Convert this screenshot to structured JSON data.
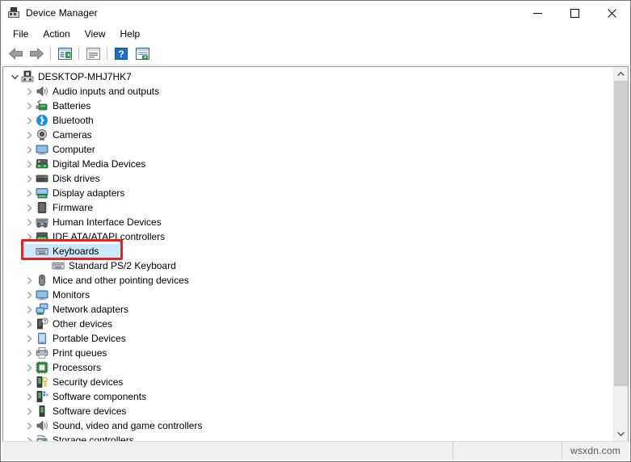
{
  "window": {
    "title": "Device Manager",
    "title_icon": "device-manager-icon",
    "minimize_label": "minimize-icon",
    "maximize_label": "maximize-icon",
    "close_label": "close-icon"
  },
  "menu": {
    "items": [
      {
        "label": "File"
      },
      {
        "label": "Action"
      },
      {
        "label": "View"
      },
      {
        "label": "Help"
      }
    ]
  },
  "toolbar": {
    "buttons": [
      {
        "name": "back-icon"
      },
      {
        "name": "forward-icon"
      },
      {
        "name": "separator"
      },
      {
        "name": "show-hide-console-tree-icon"
      },
      {
        "name": "separator"
      },
      {
        "name": "properties-icon"
      },
      {
        "name": "separator"
      },
      {
        "name": "help-icon"
      },
      {
        "name": "scan-for-hardware-changes-icon"
      }
    ]
  },
  "tree": {
    "root": {
      "label": "DESKTOP-MHJ7HK7",
      "icon": "computer-icon",
      "expanded": true
    },
    "items": [
      {
        "label": "Audio inputs and outputs",
        "icon": "speaker-icon",
        "level": 1,
        "expanded": false
      },
      {
        "label": "Batteries",
        "icon": "battery-icon",
        "level": 1,
        "expanded": false
      },
      {
        "label": "Bluetooth",
        "icon": "bluetooth-icon",
        "level": 1,
        "expanded": false
      },
      {
        "label": "Cameras",
        "icon": "camera-icon",
        "level": 1,
        "expanded": false
      },
      {
        "label": "Computer",
        "icon": "monitor-icon",
        "level": 1,
        "expanded": false
      },
      {
        "label": "Digital Media Devices",
        "icon": "media-device-icon",
        "level": 1,
        "expanded": false
      },
      {
        "label": "Disk drives",
        "icon": "disk-drive-icon",
        "level": 1,
        "expanded": false
      },
      {
        "label": "Display adapters",
        "icon": "display-adapter-icon",
        "level": 1,
        "expanded": false
      },
      {
        "label": "Firmware",
        "icon": "firmware-chip-icon",
        "level": 1,
        "expanded": false
      },
      {
        "label": "Human Interface Devices",
        "icon": "hid-gamepad-icon",
        "level": 1,
        "expanded": false
      },
      {
        "label": "IDE ATA/ATAPI controllers",
        "icon": "ide-controller-icon",
        "level": 1,
        "expanded": false
      },
      {
        "label": "Keyboards",
        "icon": "keyboard-icon",
        "level": 1,
        "expanded": true,
        "selected": true,
        "highlighted": true
      },
      {
        "label": "Standard PS/2 Keyboard",
        "icon": "keyboard-icon",
        "level": 2,
        "expanded": null
      },
      {
        "label": "Mice and other pointing devices",
        "icon": "mouse-icon",
        "level": 1,
        "expanded": false
      },
      {
        "label": "Monitors",
        "icon": "monitor-icon",
        "level": 1,
        "expanded": false
      },
      {
        "label": "Network adapters",
        "icon": "network-adapter-icon",
        "level": 1,
        "expanded": false
      },
      {
        "label": "Other devices",
        "icon": "unknown-device-icon",
        "level": 1,
        "expanded": false
      },
      {
        "label": "Portable Devices",
        "icon": "portable-device-icon",
        "level": 1,
        "expanded": false
      },
      {
        "label": "Print queues",
        "icon": "printer-icon",
        "level": 1,
        "expanded": false
      },
      {
        "label": "Processors",
        "icon": "processor-icon",
        "level": 1,
        "expanded": false
      },
      {
        "label": "Security devices",
        "icon": "security-device-icon",
        "level": 1,
        "expanded": false
      },
      {
        "label": "Software components",
        "icon": "software-component-icon",
        "level": 1,
        "expanded": false
      },
      {
        "label": "Software devices",
        "icon": "software-device-icon",
        "level": 1,
        "expanded": false
      },
      {
        "label": "Sound, video and game controllers",
        "icon": "sound-controller-icon",
        "level": 1,
        "expanded": false
      },
      {
        "label": "Storage controllers",
        "icon": "storage-controller-icon",
        "level": 1,
        "expanded": false
      }
    ]
  },
  "annotation": {
    "target_label": "Keyboards",
    "color": "#e8221f"
  },
  "scrollbar": {
    "up_arrow": "chevron-up-icon",
    "down_arrow": "chevron-down-icon"
  },
  "statusbar": {
    "watermark": "wsxdn.com"
  },
  "colors": {
    "selection": "#cce8ff",
    "annotation": "#e8221f",
    "accent_blue": "#0078d7"
  }
}
